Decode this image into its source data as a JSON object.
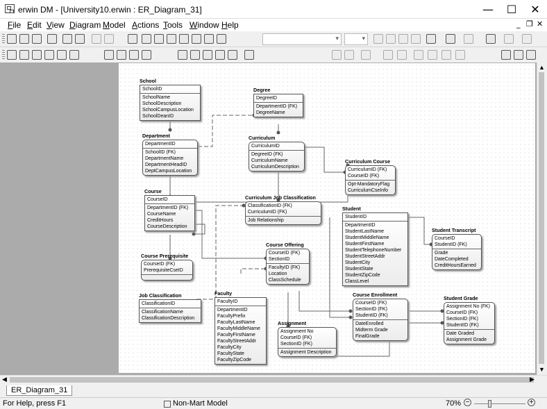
{
  "window": {
    "title": "erwin DM - [University10.erwin : ER_Diagram_31]",
    "min": "—",
    "max": "☐",
    "close": "✕",
    "mdi_min": "_",
    "mdi_restore": "❐",
    "mdi_close": "✕"
  },
  "menu": [
    "File",
    "Edit",
    "View",
    "Diagram",
    "Model",
    "Actions",
    "Tools",
    "Window",
    "Help"
  ],
  "tab": {
    "label": "ER_Diagram_31"
  },
  "status": {
    "help": "For Help, press F1",
    "model": "Non-Mart Model",
    "zoom": "70%"
  },
  "entities": {
    "school": {
      "name": "School",
      "pk": [
        "SchoolID"
      ],
      "attrs": [
        "SchoolName",
        "SchoolDescription",
        "SchoolCampusLocation",
        "SchoolDeanID"
      ]
    },
    "department": {
      "name": "Department",
      "pk": [
        "DepartmentID"
      ],
      "attrs": [
        "SchoolID (FK)",
        "DepartmentName",
        "DepartmentHeadID",
        "DeptCampusLocation"
      ]
    },
    "degree": {
      "name": "Degree",
      "pk": [
        "DegreeID"
      ],
      "attrs": [
        "DepartmentID (FK)",
        "DegreeName"
      ]
    },
    "curriculum": {
      "name": "Curriculum",
      "pk": [
        "CurriculumID"
      ],
      "attrs": [
        "DegreeID (FK)",
        "CurriculumName",
        "CurriculumDescription"
      ]
    },
    "curriculum_course": {
      "name": "Curriculum Course",
      "pk": [
        "CurriculumID (FK)",
        "CourseID (FK)"
      ],
      "attrs": [
        "Opt-MandatoryFlag",
        "CurriculumCseInfo"
      ]
    },
    "course": {
      "name": "Course",
      "pk": [
        "CourseID"
      ],
      "attrs": [
        "DepartmentID (FK)",
        "CourseName",
        "CreditHours",
        "CourseDescription"
      ]
    },
    "curriculum_job": {
      "name": "Curriculum Job Classification",
      "pk": [
        "ClassificationID (FK)",
        "CurriculumID (FK)"
      ],
      "attrs": [
        "Job Relationship"
      ]
    },
    "student": {
      "name": "Student",
      "pk": [
        "StudentID"
      ],
      "attrs": [
        "DepartmentID",
        "StudentLastName",
        "StudentMiddleName",
        "StudentFirstName",
        "StudentTelephoneNumber",
        "StudentStreetAddr",
        "StudentCity",
        "StudentState",
        "StudentZipCode",
        "ClassLevel"
      ]
    },
    "student_transcript": {
      "name": "Student Transcript",
      "pk": [
        "CourseID",
        "StudentID (FK)"
      ],
      "attrs": [
        "Grade",
        "DateCompleted",
        "CreditHoursEarned"
      ]
    },
    "course_prereq": {
      "name": "Course Prerequisite",
      "pk": [
        "CourseID (FK)",
        "PrerequisiteCseID"
      ],
      "attrs": []
    },
    "course_offering": {
      "name": "Course Offering",
      "pk": [
        "CourseID (FK)",
        "SectionID"
      ],
      "attrs": [
        "FacultyID (FK)",
        "Location",
        "ClassSchedule"
      ]
    },
    "job_class": {
      "name": "Job Classification",
      "pk": [
        "ClassificationID"
      ],
      "attrs": [
        "ClassificationName",
        "ClassificationDescription"
      ]
    },
    "faculty": {
      "name": "Faculty",
      "pk": [
        "FacultyID"
      ],
      "attrs": [
        "DepartmentID",
        "FacultyPrefix",
        "FacultyLastName",
        "FacultyMiddleName",
        "FacultyFirstName",
        "FacultyStreetAddr",
        "FacultyCity",
        "FacultyState",
        "FacultyZipCode"
      ]
    },
    "course_enrollment": {
      "name": "Course Enrollment",
      "pk": [
        "CourseID (FK)",
        "SectionID (FK)",
        "StudentID (FK)"
      ],
      "attrs": [
        "DateEnrolled",
        "Midterm Grade",
        "FinalGrade"
      ]
    },
    "student_grade": {
      "name": "Student Grade",
      "pk": [
        "Assignment No (FK)",
        "CourseID (FK)",
        "SectionID (FK)",
        "StudentID (FK)"
      ],
      "attrs": [
        "Date Graded",
        "Assignment Grade"
      ]
    },
    "assignment": {
      "name": "Assignment",
      "pk": [
        "Assignment No",
        "CourseID (FK)",
        "SectionID (FK)"
      ],
      "attrs": [
        "Assignment Description"
      ]
    }
  }
}
